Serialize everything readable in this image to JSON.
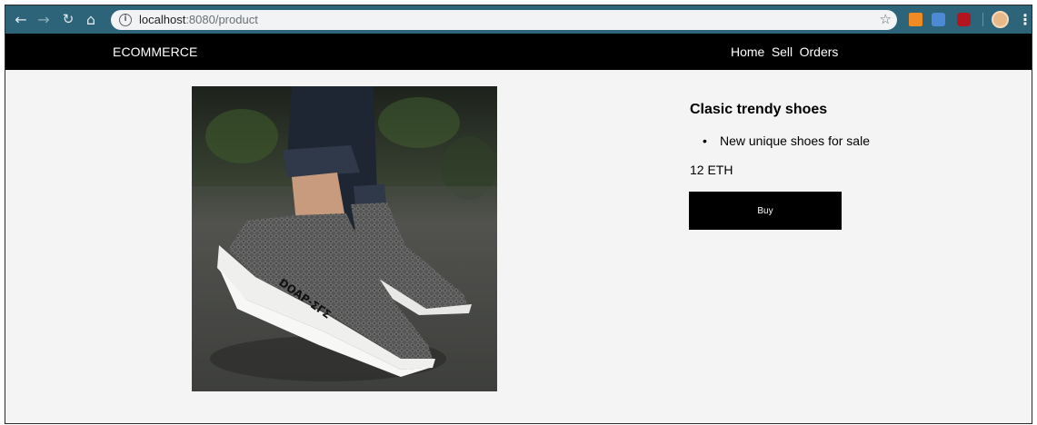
{
  "browser": {
    "url_host": "localhost",
    "url_rest": ":8080/product",
    "icons": [
      "back-arrow-icon",
      "forward-arrow-icon",
      "reload-icon",
      "home-icon",
      "info-icon",
      "bookmark-star-icon",
      "menu-dots-icon"
    ]
  },
  "navbar": {
    "brand": "ECOMMERCE",
    "links": [
      "Home",
      "Sell",
      "Orders"
    ]
  },
  "product": {
    "title": "Clasic trendy shoes",
    "features": [
      "New unique shoes for sale"
    ],
    "price": "12 ETH",
    "buy_label": "Buy",
    "image": "product-photo-sneaker"
  }
}
